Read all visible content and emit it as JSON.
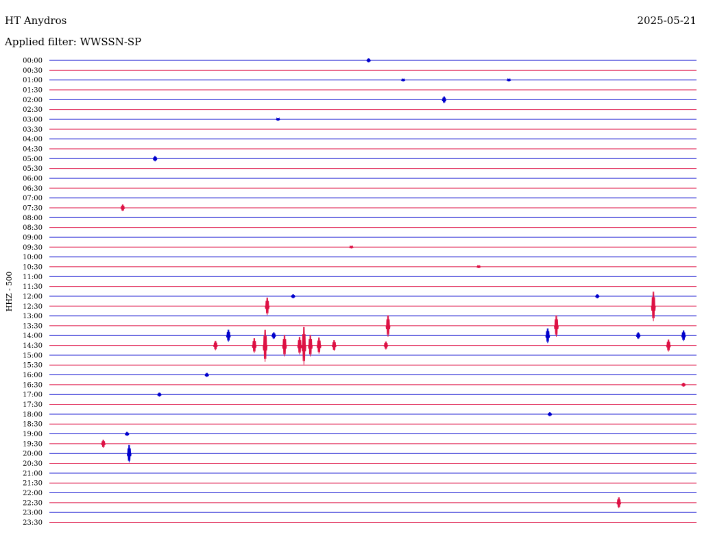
{
  "header": {
    "station": "HT Anydros",
    "date": "2025-05-21",
    "filter_text": "Applied filter: WWSSN-SP"
  },
  "channel_label": "HHZ - 500",
  "colors": {
    "trace_a": "#0000cc",
    "trace_b": "#dd1144",
    "text": "#000000",
    "background": "#ffffff"
  },
  "chart_data": {
    "type": "line",
    "title": "HT Anydros",
    "subtitle": "Applied filter: WWSSN-SP",
    "ylabel": "HHZ - 500",
    "xlabel": "",
    "grid": false,
    "legend": "none",
    "row_interval_minutes": 30,
    "row_colors": [
      "#0000cc",
      "#dd1144"
    ],
    "rows": [
      "00:00",
      "00:30",
      "01:00",
      "01:30",
      "02:00",
      "02:30",
      "03:00",
      "03:30",
      "04:00",
      "04:30",
      "05:00",
      "05:30",
      "06:00",
      "06:30",
      "07:00",
      "07:30",
      "08:00",
      "08:30",
      "09:00",
      "09:30",
      "10:00",
      "10:30",
      "11:00",
      "11:30",
      "12:00",
      "12:30",
      "13:00",
      "13:30",
      "14:00",
      "14:30",
      "15:00",
      "15:30",
      "16:00",
      "16:30",
      "17:00",
      "17:30",
      "18:00",
      "18:30",
      "19:00",
      "19:30",
      "20:00",
      "20:30",
      "21:00",
      "21:30",
      "22:00",
      "22:30",
      "23:00",
      "23:30"
    ],
    "events": [
      {
        "row": "00:00",
        "minute": 14.8,
        "amplitude": 3
      },
      {
        "row": "01:00",
        "minute": 16.4,
        "amplitude": 2
      },
      {
        "row": "01:00",
        "minute": 21.3,
        "amplitude": 2
      },
      {
        "row": "02:00",
        "minute": 18.3,
        "amplitude": 5
      },
      {
        "row": "03:00",
        "minute": 10.6,
        "amplitude": 2
      },
      {
        "row": "05:00",
        "minute": 4.9,
        "amplitude": 4
      },
      {
        "row": "07:30",
        "minute": 3.4,
        "amplitude": 5
      },
      {
        "row": "09:30",
        "minute": 14.0,
        "amplitude": 2
      },
      {
        "row": "10:30",
        "minute": 19.9,
        "amplitude": 2
      },
      {
        "row": "12:00",
        "minute": 11.3,
        "amplitude": 3
      },
      {
        "row": "12:00",
        "minute": 25.4,
        "amplitude": 3
      },
      {
        "row": "12:30",
        "minute": 10.1,
        "amplitude": 13
      },
      {
        "row": "12:30",
        "minute": 28.0,
        "amplitude": 22
      },
      {
        "row": "13:30",
        "minute": 15.7,
        "amplitude": 16
      },
      {
        "row": "13:30",
        "minute": 23.5,
        "amplitude": 16
      },
      {
        "row": "14:00",
        "minute": 8.3,
        "amplitude": 9
      },
      {
        "row": "14:00",
        "minute": 10.4,
        "amplitude": 5
      },
      {
        "row": "14:00",
        "minute": 23.1,
        "amplitude": 11
      },
      {
        "row": "14:00",
        "minute": 27.3,
        "amplitude": 5
      },
      {
        "row": "14:00",
        "minute": 29.4,
        "amplitude": 8
      },
      {
        "row": "14:30",
        "minute": 7.7,
        "amplitude": 7
      },
      {
        "row": "14:30",
        "minute": 9.5,
        "amplitude": 11
      },
      {
        "row": "14:30",
        "minute": 10.0,
        "amplitude": 24
      },
      {
        "row": "14:30",
        "minute": 10.9,
        "amplitude": 16
      },
      {
        "row": "14:30",
        "minute": 11.6,
        "amplitude": 13
      },
      {
        "row": "14:30",
        "minute": 11.8,
        "amplitude": 28
      },
      {
        "row": "14:30",
        "minute": 12.1,
        "amplitude": 16
      },
      {
        "row": "14:30",
        "minute": 12.5,
        "amplitude": 12
      },
      {
        "row": "14:30",
        "minute": 13.2,
        "amplitude": 8
      },
      {
        "row": "14:30",
        "minute": 15.6,
        "amplitude": 6
      },
      {
        "row": "14:30",
        "minute": 28.7,
        "amplitude": 9
      },
      {
        "row": "16:00",
        "minute": 7.3,
        "amplitude": 3
      },
      {
        "row": "16:30",
        "minute": 29.4,
        "amplitude": 3
      },
      {
        "row": "17:00",
        "minute": 5.1,
        "amplitude": 3
      },
      {
        "row": "18:00",
        "minute": 23.2,
        "amplitude": 3
      },
      {
        "row": "19:00",
        "minute": 3.6,
        "amplitude": 3
      },
      {
        "row": "19:30",
        "minute": 2.5,
        "amplitude": 6
      },
      {
        "row": "20:00",
        "minute": 3.7,
        "amplitude": 13
      },
      {
        "row": "22:30",
        "minute": 26.4,
        "amplitude": 8
      }
    ]
  }
}
